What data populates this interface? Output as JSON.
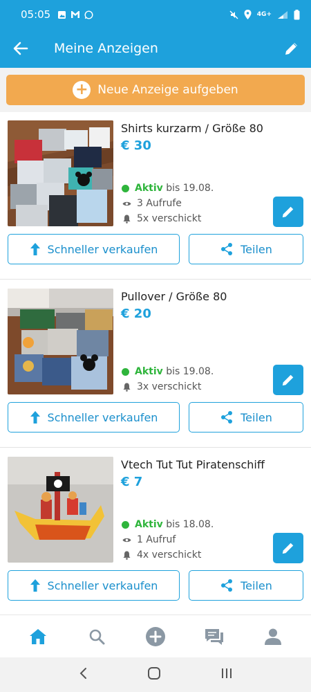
{
  "status_bar": {
    "time": "05:05",
    "network": "4G+"
  },
  "app_bar": {
    "title": "Meine Anzeigen"
  },
  "new_ad_button": {
    "label": "Neue Anzeige aufgeben"
  },
  "listings": [
    {
      "title": "Shirts kurzarm / Größe 80",
      "price": "€ 30",
      "status": "Aktiv",
      "until": "bis 19.08.",
      "views": "3 Aufrufe",
      "sent": "5x verschickt",
      "thumbnail": "shirts-photo"
    },
    {
      "title": "Pullover / Größe 80",
      "price": "€ 20",
      "status": "Aktiv",
      "until": "bis 19.08.",
      "views": null,
      "sent": "3x verschickt",
      "thumbnail": "pullover-photo"
    },
    {
      "title": "Vtech Tut Tut Piratenschiff",
      "price": "€ 7",
      "status": "Aktiv",
      "until": "bis 18.08.",
      "views": "1 Aufruf",
      "sent": "4x verschickt",
      "thumbnail": "pirate-ship-photo"
    }
  ],
  "actions": {
    "sell_faster": "Schneller verkaufen",
    "share": "Teilen"
  },
  "bottom_nav": [
    "home-icon",
    "search-icon",
    "add-icon",
    "messages-icon",
    "profile-icon"
  ],
  "colors": {
    "primary": "#1ea1dc",
    "accent": "#f2a94f",
    "active": "#2fb53c"
  }
}
